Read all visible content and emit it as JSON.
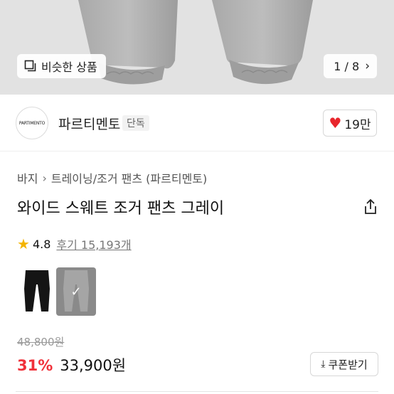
{
  "hero": {
    "similar_label": "비슷한 상품",
    "page_indicator": "1 / 8",
    "icons": {
      "similar": "similar-items-icon",
      "next": "chevron-right-icon"
    }
  },
  "seller": {
    "logo_text": "PARTIMENTO",
    "name": "파르티멘토",
    "badge": "단독",
    "likes": "19만",
    "colors": {
      "heart": "#e8262c"
    }
  },
  "product": {
    "breadcrumb": [
      "바지",
      "트레이닝/조거 팬츠 (파르티멘토)"
    ],
    "title": "와이드 스웨트 조거 팬츠 그레이",
    "rating": "4.8",
    "reviews": "후기 15,193개",
    "variants": [
      {
        "color": "#151515",
        "selected": false
      },
      {
        "color": "#8a8a8a",
        "selected": true
      }
    ],
    "original_price": "48,800원",
    "discount": "31%",
    "price": "33,900원",
    "coupon_label": "쿠폰받기",
    "colors": {
      "discount": "#f0313a",
      "star": "#f4b400"
    }
  }
}
